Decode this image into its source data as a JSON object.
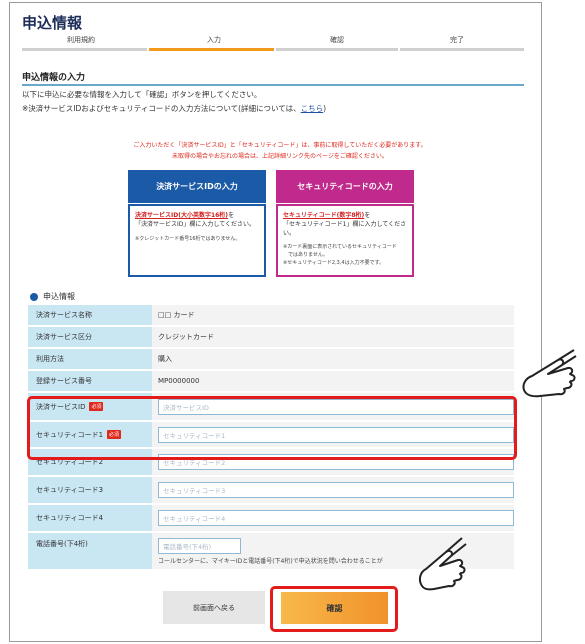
{
  "header": {
    "title": "申込情報",
    "steps": [
      "利用規約",
      "入力",
      "確認",
      "完了"
    ],
    "active_step": 1
  },
  "section": {
    "title": "申込情報の入力",
    "lead1": "以下に申込に必要な情報を入力して「確認」ボタンを押してください。",
    "lead2_prefix": "※決済サービスIDおよびセキュリティコードの入力方法について(詳細については、",
    "lead2_link": "こちら",
    "lead2_suffix": ")"
  },
  "notice": {
    "line1": "ご入力いただく「決済サービスID」と「セキュリティコード」は、事前に取得していただく必要があります。",
    "line2": "未取得の場合やお忘れの場合は、上記詳細リンク先のページをご確認ください。"
  },
  "guide": {
    "id_box": {
      "header": "決済サービスIDの入力",
      "link": "決済サービスID(大小英数字16桁)",
      "text1": "を",
      "text2": "「決済サービスID」欄に入力してください。",
      "note": "※クレジットカード番号16桁ではありません。"
    },
    "code_box": {
      "header": "セキュリティコードの入力",
      "link": "セキュリティコード(数字8桁)",
      "text1": "を",
      "text2": "「セキュリティコード1」欄に入力してください。",
      "note1": "※カード裏面に表示されているセキュリティコード",
      "note2": "　ではありません。",
      "note3": "※セキュリティコード2,3,4は入力不要です。"
    }
  },
  "form": {
    "section_label": "申込情報",
    "required_badge": "必須",
    "rows": [
      {
        "label": "決済サービス名称",
        "value": "□□ カード"
      },
      {
        "label": "決済サービス区分",
        "value": "クレジットカード"
      },
      {
        "label": "利用方法",
        "value": "購入"
      },
      {
        "label": "登録サービス番号",
        "value": "MP0000000"
      }
    ],
    "inputs": [
      {
        "label": "決済サービスID",
        "placeholder": "決済サービスID"
      },
      {
        "label": "セキュリティコード1",
        "placeholder": "セキュリティコード1"
      },
      {
        "label": "セキュリティコード2",
        "placeholder": "セキュリティコード2"
      },
      {
        "label": "セキュリティコード3",
        "placeholder": "セキュリティコード3"
      },
      {
        "label": "セキュリティコード4",
        "placeholder": "セキュリティコード4"
      }
    ],
    "tel": {
      "label": "電話番号(下4桁)",
      "placeholder": "電話番号(下4桁)",
      "note": "コールセンターに、マイキーIDと電話番号(下4桁)で申込状況を問い合わせることが"
    }
  },
  "buttons": {
    "back": "前画面へ戻る",
    "confirm": "確認"
  },
  "colors": {
    "accent_blue": "#1b5aa6",
    "accent_pink": "#c02a8c",
    "highlight_red": "#e31b1b",
    "confirm_orange": "#f39a1e"
  },
  "icons": {
    "pointer_hand_top": "pointing-hand-icon",
    "pointer_hand_bottom": "pointing-hand-icon"
  }
}
